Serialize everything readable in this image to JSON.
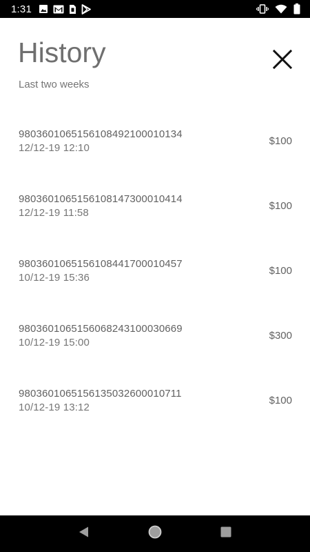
{
  "status_bar": {
    "time": "1:31",
    "left_icons": [
      "image-icon",
      "gmail-icon",
      "sim-card-icon",
      "play-store-icon"
    ],
    "right_icons": [
      "vibrate-icon",
      "wifi-icon",
      "battery-icon"
    ]
  },
  "header": {
    "title": "History",
    "subtitle": "Last two weeks",
    "close_icon": "close-icon"
  },
  "history": [
    {
      "id": "9803601065156108492100010134",
      "datetime": "12/12-19 12:10",
      "amount": "$100"
    },
    {
      "id": "9803601065156108147300010414",
      "datetime": "12/12-19 11:58",
      "amount": "$100"
    },
    {
      "id": "9803601065156108441700010457",
      "datetime": "10/12-19 15:36",
      "amount": "$100"
    },
    {
      "id": "9803601065156068243100030669",
      "datetime": "10/12-19 15:00",
      "amount": "$300"
    },
    {
      "id": "9803601065156135032600010711",
      "datetime": "10/12-19 13:12",
      "amount": "$100"
    }
  ],
  "nav_bar": {
    "buttons": [
      "back-icon",
      "home-icon",
      "recents-icon"
    ]
  },
  "colors": {
    "title": "#6f6f6f",
    "text": "#616161",
    "secondary_text": "#757575",
    "system_bar": "#000000",
    "nav_icon": "#9e9e9e"
  }
}
